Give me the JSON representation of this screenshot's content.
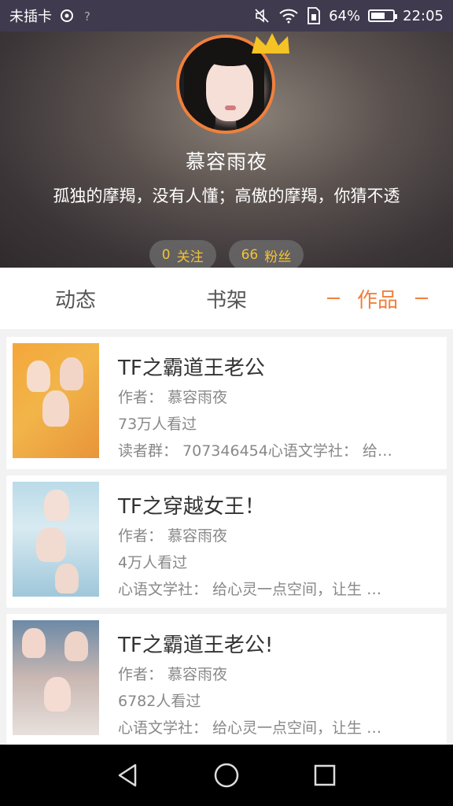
{
  "status_bar": {
    "carrier": "未插卡",
    "battery_percent": "64%",
    "battery_level": 0.64,
    "time": "22:05"
  },
  "profile": {
    "nickname": "慕容雨夜",
    "bio": "孤独的摩羯，没有人懂；高傲的摩羯，你猜不透",
    "follow_count": "0",
    "follow_label": "关注",
    "fans_count": "66",
    "fans_label": "粉丝"
  },
  "tabs": [
    {
      "label": "动态",
      "active": false
    },
    {
      "label": "书架",
      "active": false
    },
    {
      "label": "作品",
      "active": true
    }
  ],
  "books": [
    {
      "title": "TF之霸道王老公",
      "author": "作者：   慕容雨夜",
      "views": "73万人看过",
      "desc": "读者群：  707346454心语文学社：  给…"
    },
    {
      "title": "TF之穿越女王！",
      "author": "作者：   慕容雨夜",
      "views": "4万人看过",
      "desc": "心语文学社：  给心灵一点空间，让生 …"
    },
    {
      "title": "TF之霸道王老公!",
      "author": "作者：   慕容雨夜",
      "views": "6782人看过",
      "desc": "心语文学社：  给心灵一点空间，让生 …"
    }
  ],
  "colors": {
    "accent": "#f0803c",
    "pill_text": "#f3c23a"
  }
}
